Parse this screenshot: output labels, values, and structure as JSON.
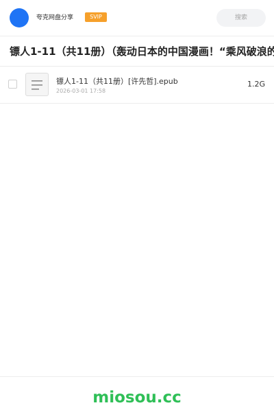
{
  "header": {
    "app_name": "夸克网盘分享",
    "badge": "SVIP",
    "search_placeholder": "搜索"
  },
  "share": {
    "title": "镖人1-11（共11册）（轰动日本的中国漫画！“乘风破浪的"
  },
  "files": [
    {
      "name": "镖人1-11（共11册）[许先哲].epub",
      "date": "2026-03-01 17:58",
      "size": "1.2G",
      "icon": "document-lines-icon"
    }
  ],
  "footer": {
    "watermark": "miosou.cc"
  },
  "colors": {
    "avatar": "#1f74f5",
    "badge": "#f6a02b",
    "watermark": "#2fbf57"
  }
}
